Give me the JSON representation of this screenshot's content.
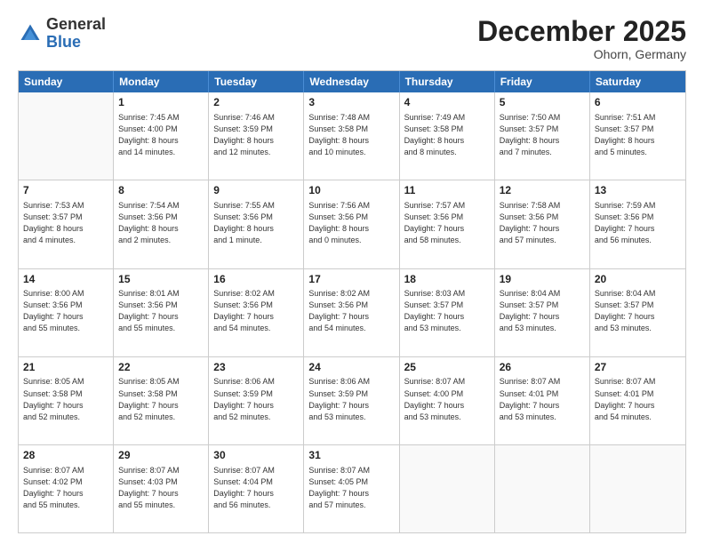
{
  "header": {
    "logo_general": "General",
    "logo_blue": "Blue",
    "month": "December 2025",
    "location": "Ohorn, Germany"
  },
  "weekdays": [
    "Sunday",
    "Monday",
    "Tuesday",
    "Wednesday",
    "Thursday",
    "Friday",
    "Saturday"
  ],
  "rows": [
    [
      {
        "day": "",
        "info": ""
      },
      {
        "day": "1",
        "info": "Sunrise: 7:45 AM\nSunset: 4:00 PM\nDaylight: 8 hours\nand 14 minutes."
      },
      {
        "day": "2",
        "info": "Sunrise: 7:46 AM\nSunset: 3:59 PM\nDaylight: 8 hours\nand 12 minutes."
      },
      {
        "day": "3",
        "info": "Sunrise: 7:48 AM\nSunset: 3:58 PM\nDaylight: 8 hours\nand 10 minutes."
      },
      {
        "day": "4",
        "info": "Sunrise: 7:49 AM\nSunset: 3:58 PM\nDaylight: 8 hours\nand 8 minutes."
      },
      {
        "day": "5",
        "info": "Sunrise: 7:50 AM\nSunset: 3:57 PM\nDaylight: 8 hours\nand 7 minutes."
      },
      {
        "day": "6",
        "info": "Sunrise: 7:51 AM\nSunset: 3:57 PM\nDaylight: 8 hours\nand 5 minutes."
      }
    ],
    [
      {
        "day": "7",
        "info": "Sunrise: 7:53 AM\nSunset: 3:57 PM\nDaylight: 8 hours\nand 4 minutes."
      },
      {
        "day": "8",
        "info": "Sunrise: 7:54 AM\nSunset: 3:56 PM\nDaylight: 8 hours\nand 2 minutes."
      },
      {
        "day": "9",
        "info": "Sunrise: 7:55 AM\nSunset: 3:56 PM\nDaylight: 8 hours\nand 1 minute."
      },
      {
        "day": "10",
        "info": "Sunrise: 7:56 AM\nSunset: 3:56 PM\nDaylight: 8 hours\nand 0 minutes."
      },
      {
        "day": "11",
        "info": "Sunrise: 7:57 AM\nSunset: 3:56 PM\nDaylight: 7 hours\nand 58 minutes."
      },
      {
        "day": "12",
        "info": "Sunrise: 7:58 AM\nSunset: 3:56 PM\nDaylight: 7 hours\nand 57 minutes."
      },
      {
        "day": "13",
        "info": "Sunrise: 7:59 AM\nSunset: 3:56 PM\nDaylight: 7 hours\nand 56 minutes."
      }
    ],
    [
      {
        "day": "14",
        "info": "Sunrise: 8:00 AM\nSunset: 3:56 PM\nDaylight: 7 hours\nand 55 minutes."
      },
      {
        "day": "15",
        "info": "Sunrise: 8:01 AM\nSunset: 3:56 PM\nDaylight: 7 hours\nand 55 minutes."
      },
      {
        "day": "16",
        "info": "Sunrise: 8:02 AM\nSunset: 3:56 PM\nDaylight: 7 hours\nand 54 minutes."
      },
      {
        "day": "17",
        "info": "Sunrise: 8:02 AM\nSunset: 3:56 PM\nDaylight: 7 hours\nand 54 minutes."
      },
      {
        "day": "18",
        "info": "Sunrise: 8:03 AM\nSunset: 3:57 PM\nDaylight: 7 hours\nand 53 minutes."
      },
      {
        "day": "19",
        "info": "Sunrise: 8:04 AM\nSunset: 3:57 PM\nDaylight: 7 hours\nand 53 minutes."
      },
      {
        "day": "20",
        "info": "Sunrise: 8:04 AM\nSunset: 3:57 PM\nDaylight: 7 hours\nand 53 minutes."
      }
    ],
    [
      {
        "day": "21",
        "info": "Sunrise: 8:05 AM\nSunset: 3:58 PM\nDaylight: 7 hours\nand 52 minutes."
      },
      {
        "day": "22",
        "info": "Sunrise: 8:05 AM\nSunset: 3:58 PM\nDaylight: 7 hours\nand 52 minutes."
      },
      {
        "day": "23",
        "info": "Sunrise: 8:06 AM\nSunset: 3:59 PM\nDaylight: 7 hours\nand 52 minutes."
      },
      {
        "day": "24",
        "info": "Sunrise: 8:06 AM\nSunset: 3:59 PM\nDaylight: 7 hours\nand 53 minutes."
      },
      {
        "day": "25",
        "info": "Sunrise: 8:07 AM\nSunset: 4:00 PM\nDaylight: 7 hours\nand 53 minutes."
      },
      {
        "day": "26",
        "info": "Sunrise: 8:07 AM\nSunset: 4:01 PM\nDaylight: 7 hours\nand 53 minutes."
      },
      {
        "day": "27",
        "info": "Sunrise: 8:07 AM\nSunset: 4:01 PM\nDaylight: 7 hours\nand 54 minutes."
      }
    ],
    [
      {
        "day": "28",
        "info": "Sunrise: 8:07 AM\nSunset: 4:02 PM\nDaylight: 7 hours\nand 55 minutes."
      },
      {
        "day": "29",
        "info": "Sunrise: 8:07 AM\nSunset: 4:03 PM\nDaylight: 7 hours\nand 55 minutes."
      },
      {
        "day": "30",
        "info": "Sunrise: 8:07 AM\nSunset: 4:04 PM\nDaylight: 7 hours\nand 56 minutes."
      },
      {
        "day": "31",
        "info": "Sunrise: 8:07 AM\nSunset: 4:05 PM\nDaylight: 7 hours\nand 57 minutes."
      },
      {
        "day": "",
        "info": ""
      },
      {
        "day": "",
        "info": ""
      },
      {
        "day": "",
        "info": ""
      }
    ]
  ]
}
